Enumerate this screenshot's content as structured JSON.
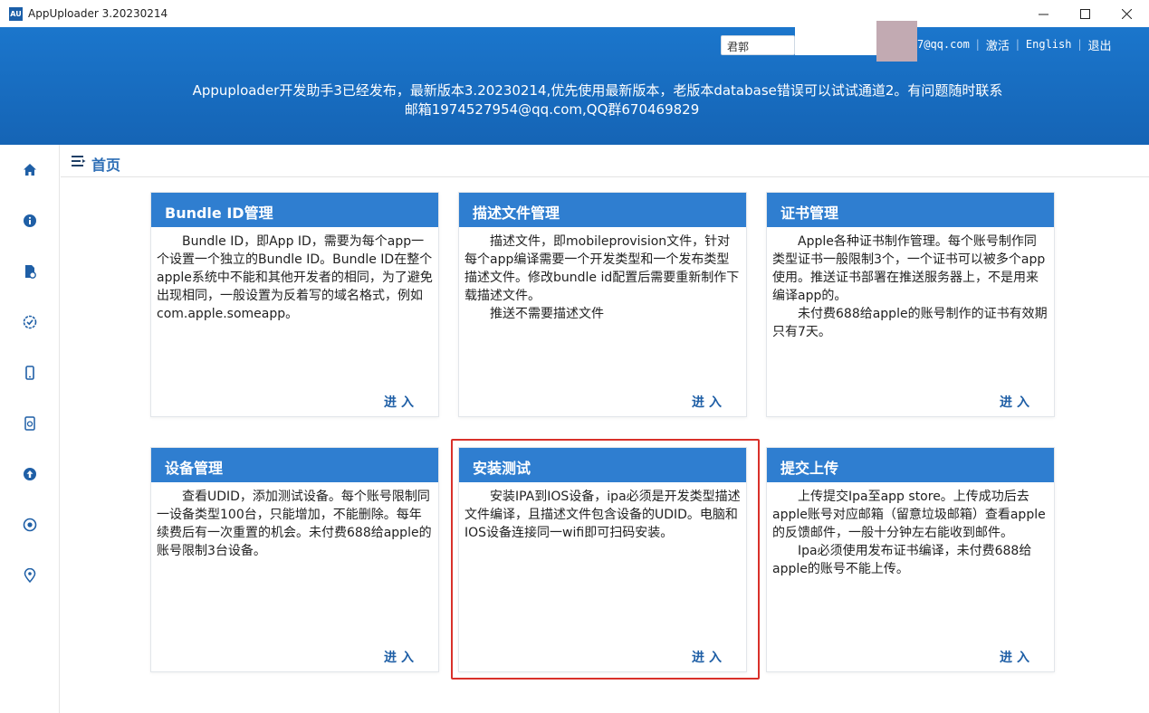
{
  "window": {
    "logo_text": "AU",
    "title": "AppUploader 3.20230214"
  },
  "header": {
    "search_value": "君郭",
    "email_partial": "7@qq.com",
    "activate_label": "激活",
    "english_label": "English",
    "logout_label": "退出",
    "notice_line1": "Appuploader开发助手3已经发布，最新版本3.20230214,优先使用最新版本，老版本database错误可以试试通道2。有问题随时联系",
    "notice_line2": "邮箱1974527954@qq.com,QQ群670469829"
  },
  "sidebar": {
    "items": [
      "home-icon",
      "info-icon",
      "file-icon",
      "check-badge-icon",
      "phone-icon",
      "doc-refresh-icon",
      "upload-icon",
      "eye-refresh-icon",
      "location-icon"
    ]
  },
  "breadcrumb": {
    "title": "首页"
  },
  "cards": [
    {
      "title": "Bundle ID管理",
      "paragraphs": [
        "Bundle ID，即App ID，需要为每个app一个设置一个独立的Bundle ID。Bundle ID在整个apple系统中不能和其他开发者的相同，为了避免出现相同，一般设置为反着写的域名格式，例如com.apple.someapp。"
      ],
      "enter": "进入"
    },
    {
      "title": "描述文件管理",
      "paragraphs": [
        "描述文件，即mobileprovision文件，针对每个app编译需要一个开发类型和一个发布类型描述文件。修改bundle id配置后需要重新制作下载描述文件。",
        "推送不需要描述文件"
      ],
      "enter": "进入"
    },
    {
      "title": "证书管理",
      "paragraphs": [
        "Apple各种证书制作管理。每个账号制作同类型证书一般限制3个，一个证书可以被多个app使用。推送证书部署在推送服务器上，不是用来编译app的。",
        "未付费688给apple的账号制作的证书有效期只有7天。"
      ],
      "enter": "进入"
    },
    {
      "title": "设备管理",
      "paragraphs": [
        "查看UDID，添加测试设备。每个账号限制同一设备类型100台，只能增加，不能删除。每年续费后有一次重置的机会。未付费688给apple的账号限制3台设备。"
      ],
      "enter": "进入"
    },
    {
      "title": "安装测试",
      "paragraphs": [
        "安装IPA到IOS设备，ipa必须是开发类型描述文件编译，且描述文件包含设备的UDID。电脑和IOS设备连接同一wifi即可扫码安装。"
      ],
      "enter": "进入"
    },
    {
      "title": "提交上传",
      "paragraphs": [
        "上传提交Ipa至app store。上传成功后去apple账号对应邮箱（留意垃圾邮箱）查看apple的反馈邮件，一般十分钟左右能收到邮件。",
        "Ipa必须使用发布证书编译，未付费688给apple的账号不能上传。"
      ],
      "enter": "进入"
    }
  ],
  "colors": {
    "header_blue": "#1b76cc",
    "card_head_blue": "#2f7ed0",
    "link_blue": "#1f5fa6",
    "highlight_red": "#d9302a"
  }
}
